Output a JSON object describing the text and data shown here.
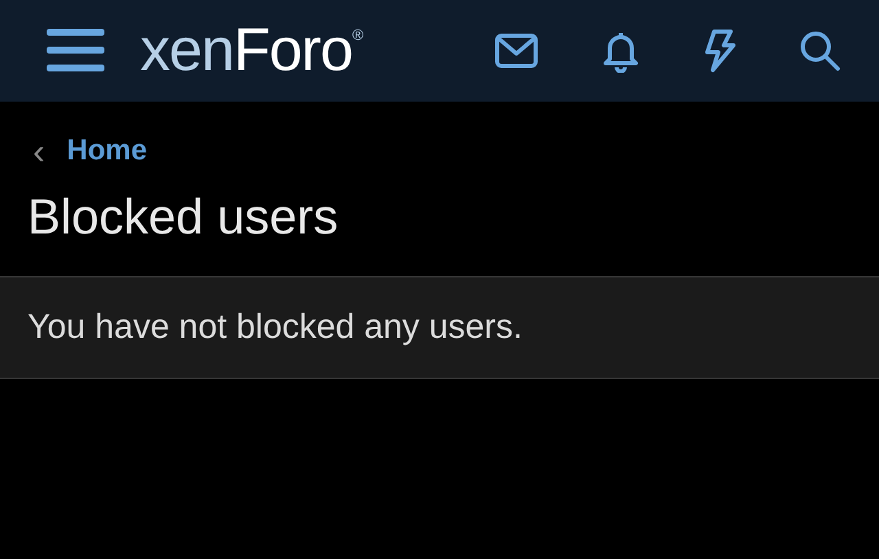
{
  "header": {
    "logo": {
      "part_1": "xen",
      "part_2": "Foro",
      "mark": "®"
    }
  },
  "breadcrumb": {
    "chevron": "‹",
    "label": "Home"
  },
  "title": "Blocked users",
  "message": "You have not blocked any users."
}
